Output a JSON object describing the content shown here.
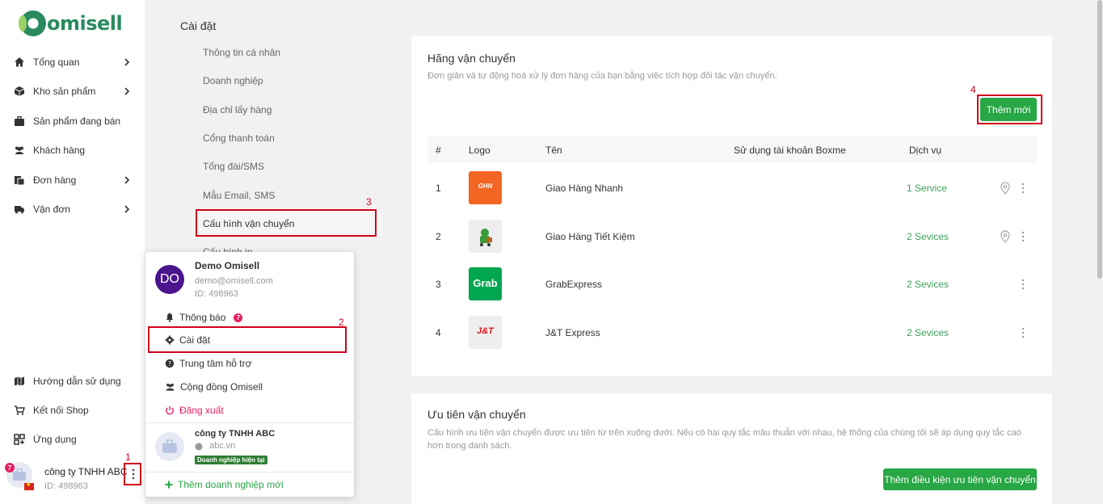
{
  "brand": {
    "name": "omisell"
  },
  "sidebar": {
    "items": [
      {
        "label": "Tổng quan",
        "icon": "home-icon",
        "chevron": true
      },
      {
        "label": "Kho sản phẩm",
        "icon": "box-icon",
        "chevron": true
      },
      {
        "label": "Sản phẩm đang bán",
        "icon": "briefcase-icon",
        "chevron": false
      },
      {
        "label": "Khách hàng",
        "icon": "users-icon",
        "chevron": false
      },
      {
        "label": "Đơn hàng",
        "icon": "orders-icon",
        "chevron": true
      },
      {
        "label": "Vận đơn",
        "icon": "truck-icon",
        "chevron": true
      }
    ],
    "bottom_items": [
      {
        "label": "Hướng dẫn sử dụng",
        "icon": "map-icon"
      },
      {
        "label": "Kết nối Shop",
        "icon": "cart-icon"
      },
      {
        "label": "Ứng dụng",
        "icon": "apps-icon"
      }
    ],
    "user": {
      "company": "công ty TNHH ABC",
      "id": "ID: 498963",
      "badge": "7"
    }
  },
  "settings": {
    "title": "Cài đặt",
    "items": [
      "Thông tin cá nhân",
      "Doanh nghiệp",
      "Địa chỉ lấy hàng",
      "Cổng thanh toán",
      "Tổng đài/SMS",
      "Mẫu Email, SMS",
      "Cấu hình vận chuyển",
      "Cấu hình in"
    ]
  },
  "carriers": {
    "title": "Hãng vận chuyển",
    "desc": "Đơn giản và tự động hoá xử lý đơn hàng của bạn bằng việc tích hợp đối tác vận chuyển.",
    "add_button": "Thêm mới",
    "columns": [
      "#",
      "Logo",
      "Tên",
      "Sử dụng tài khoản Boxme",
      "Dịch vụ"
    ],
    "rows": [
      {
        "num": "1",
        "name": "Giao Hàng Nhanh",
        "services": "1 Service",
        "logo": "ghn-logo",
        "logo_text": "GHN",
        "has_pin": true
      },
      {
        "num": "2",
        "name": "Giao Hàng Tiết Kiệm",
        "services": "2 Sevices",
        "logo": "ghtk-logo",
        "logo_text": "",
        "has_pin": true
      },
      {
        "num": "3",
        "name": "GrabExpress",
        "services": "2 Sevices",
        "logo": "grab-logo",
        "logo_text": "Grab",
        "has_pin": false
      },
      {
        "num": "4",
        "name": "J&T Express",
        "services": "2 Sevices",
        "logo": "jt-logo",
        "logo_text": "J&T",
        "has_pin": false
      }
    ]
  },
  "priority": {
    "title": "Ưu tiên vận chuyển",
    "desc": "Cấu hình ưu tiên vận chuyển được ưu tiên từ trên xuống dưới. Nếu có hai quy tắc mâu thuẫn với nhau, hệ thống của chúng tôi sẽ áp dụng quy tắc cao hơn trong danh sách.",
    "add_button": "Thêm điều kiện ưu tiên vận chuyển"
  },
  "dropdown": {
    "user_name": "Demo Omisell",
    "email": "demo@omisell.com",
    "id": "ID: 498963",
    "initials": "DO",
    "notification_label": "Thông báo",
    "notification_count": "7",
    "settings_label": "Cài đặt",
    "support_label": "Trung tâm hỗ trợ",
    "community_label": "Cộng đồng Omisell",
    "logout_label": "Đăng xuất",
    "company_name": "công ty TNHH ABC",
    "company_site": "abc.vn",
    "company_tag": "Doanh nghiệp hiện tại",
    "add_company": "Thêm doanh nghiệp mới"
  },
  "annotations": [
    "1",
    "2",
    "3",
    "4"
  ],
  "colors": {
    "accent": "#28a745",
    "annotation": "#d0021b",
    "brand": "#2a8a5f"
  }
}
